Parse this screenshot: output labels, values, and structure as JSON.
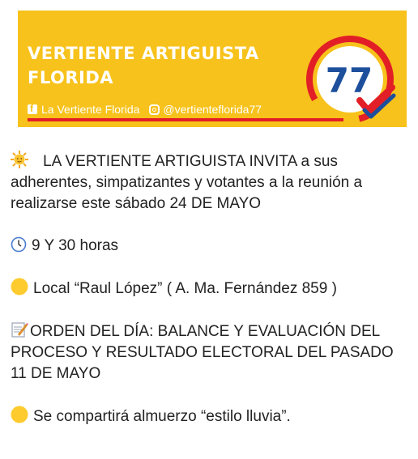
{
  "banner": {
    "title_line1": "VERTIENTE  ARTIGUISTA",
    "title_line2": "FLORIDA",
    "facebook": "La Vertiente Florida",
    "instagram": "@vertienteflorida77",
    "logo_number": "77",
    "colors": {
      "background": "#f7c21b",
      "red": "#e21f26",
      "blue": "#1d4f9c"
    }
  },
  "message": {
    "intro_icon": "sun-face-emoji",
    "intro": "LA VERTIENTE ARTIGUISTA INVITA a sus adherentes, simpatizantes y votantes a la reunión a realizarse este sábado 24 DE MAYO",
    "time_icon": "clock-emoji",
    "time": "9 Y 30 horas",
    "place_icon": "yellow-circle-emoji",
    "place": "Local “Raul López” ( A. Ma. Fernández 859 )",
    "agenda_icon": "memo-emoji",
    "agenda": "ORDEN DEL DÍA: BALANCE Y EVALUACIÓN DEL PROCESO Y RESULTADO ELECTORAL DEL PASADO 11 DE MAYO",
    "lunch_icon": "yellow-circle-emoji",
    "lunch": "Se compartirá almuerzo “estilo lluvia”."
  }
}
